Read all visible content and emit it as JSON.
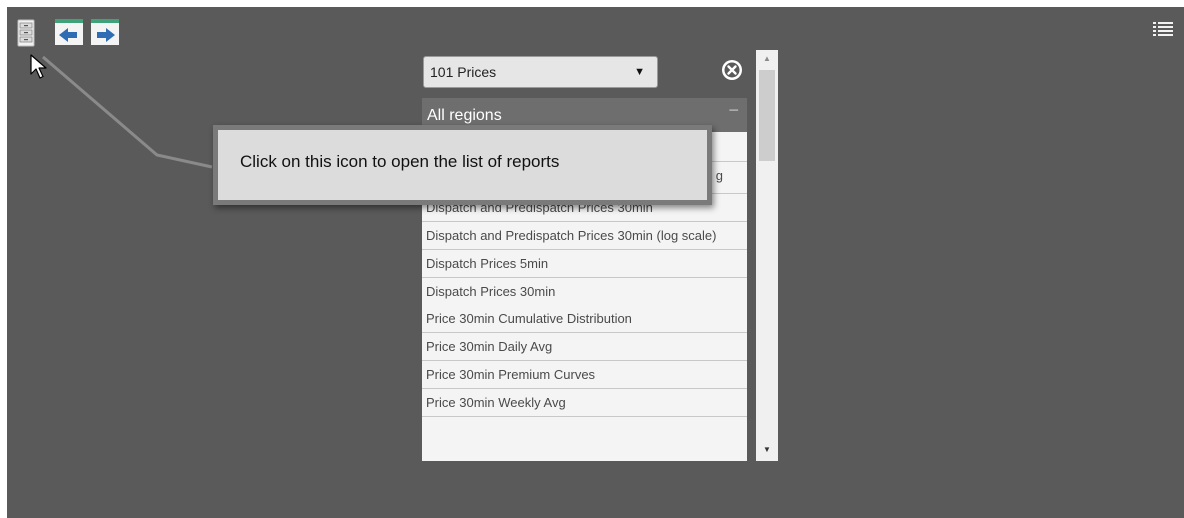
{
  "toolbar": {
    "reports_icon": "reports-list-icon",
    "back_icon": "back-arrow-icon",
    "forward_icon": "forward-arrow-icon",
    "menu_icon": "list-menu-icon"
  },
  "panel": {
    "selected_report_group": "101 Prices",
    "close_icon": "close-circle-icon",
    "region_header": "All regions",
    "region_collapse": "−",
    "reports": [
      "Dispatch and Predispatch Prices 30min",
      "Dispatch and Predispatch Prices 30min (log scale)",
      "Dispatch Prices 5min",
      "Dispatch Prices 30min",
      "Price 30min Cumulative Distribution",
      "Price 30min Daily Avg",
      "Price 30min Premium Curves",
      "Price 30min Weekly Avg"
    ],
    "partial_report_tail": "g",
    "scroll_up": "▲",
    "scroll_down": "▼",
    "select_arrow": "▼"
  },
  "tooltip": {
    "text": "Click on this icon to open the list of reports"
  },
  "colors": {
    "background": "#5a5a5a",
    "tooltip_bg": "#dcdcdc",
    "tooltip_border": "#7a7a7a",
    "icon_green": "#3fa27a",
    "icon_blue": "#2e6db4"
  }
}
